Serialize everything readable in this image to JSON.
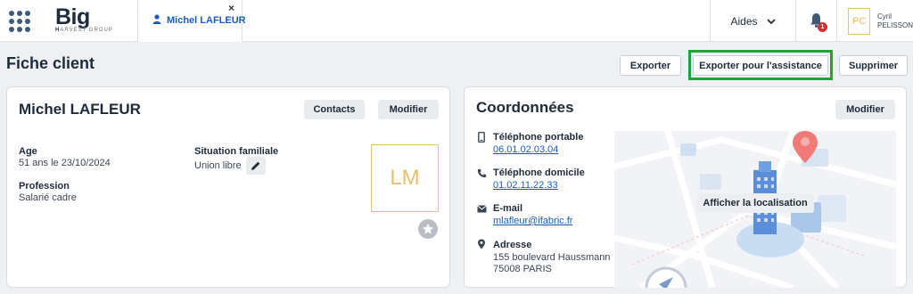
{
  "topbar": {
    "logo_main": "Big",
    "logo_sub_bold": "H",
    "logo_sub": "ARVEST GROUP",
    "tab_label": "Michel LAFLEUR",
    "tab_close": "×",
    "aides_label": "Aides",
    "notification_count": "1",
    "user_initials": "PC",
    "user_first": "Cyril",
    "user_last": "PELISSON"
  },
  "page": {
    "title": "Fiche client",
    "buttons": {
      "exporter": "Exporter",
      "exporter_assistance": "Exporter pour l'assistance",
      "supprimer": "Supprimer"
    }
  },
  "client_card": {
    "name": "Michel LAFLEUR",
    "contacts_button": "Contacts",
    "modifier_button": "Modifier",
    "age_label": "Age",
    "age_value": "51 ans le 23/10/2024",
    "situation_label": "Situation familiale",
    "situation_value": "Union libre",
    "profession_label": "Profession",
    "profession_value": "Salarié cadre",
    "photo_initials": "LM"
  },
  "coord_card": {
    "title": "Coordonnées",
    "modifier_button": "Modifier",
    "tel_portable_label": "Téléphone portable",
    "tel_portable_value": "06.01.02.03.04",
    "tel_domicile_label": "Téléphone domicile",
    "tel_domicile_value": "01.02.11.22.33",
    "email_label": "E-mail",
    "email_value": "mlafleur@ifabric.fr",
    "adresse_label": "Adresse",
    "adresse_line1": "155 boulevard Haussmann",
    "adresse_line2": "75008 PARIS",
    "map_button": "Afficher la localisation"
  },
  "colors": {
    "accent_blue": "#1a5bbf",
    "highlight_green": "#22a33a",
    "badge_red": "#d32f2f",
    "avatar_gold": "#e8c46a"
  },
  "icons": [
    "apps-grid-icon",
    "user-icon",
    "close-icon",
    "chevron-down-icon",
    "bell-icon",
    "pencil-icon",
    "star-icon",
    "mobile-phone-icon",
    "phone-icon",
    "mail-icon",
    "location-pin-icon"
  ]
}
